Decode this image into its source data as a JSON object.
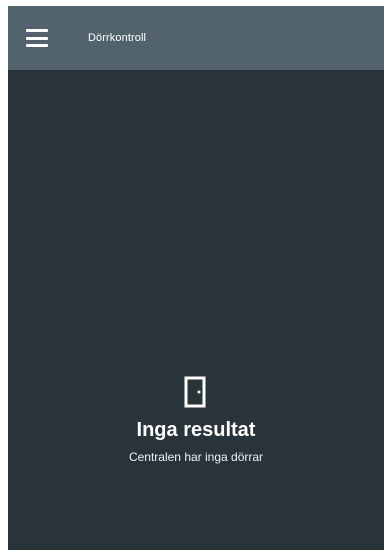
{
  "app_bar": {
    "title": "Dörrkontroll",
    "menu_icon": "menu-icon",
    "background": "#53636d"
  },
  "main": {
    "background": "#29333a",
    "empty_state": {
      "icon": "door-icon",
      "title": "Inga resultat",
      "subtitle": "Centralen har inga dörrar"
    }
  }
}
